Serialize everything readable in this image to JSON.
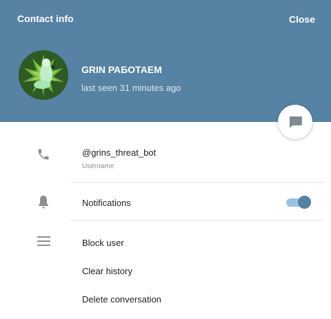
{
  "header": {
    "title": "Contact info",
    "close_label": "Close",
    "background_color": "#5682a3"
  },
  "user": {
    "name": "GRIN РАБОТАЕМ",
    "status": "last seen 31 minutes ago"
  },
  "username": {
    "value": "@grins_threat_bot",
    "label": "Username",
    "icon": "phone-icon"
  },
  "notifications": {
    "label": "Notifications",
    "enabled": true,
    "icon": "bell-icon"
  },
  "actions": {
    "icon": "menu-icon",
    "block_user": "Block user",
    "clear_history": "Clear history",
    "delete_conversation": "Delete conversation"
  },
  "fab": {
    "icon": "message-icon"
  },
  "accent_color": "#5682a3"
}
